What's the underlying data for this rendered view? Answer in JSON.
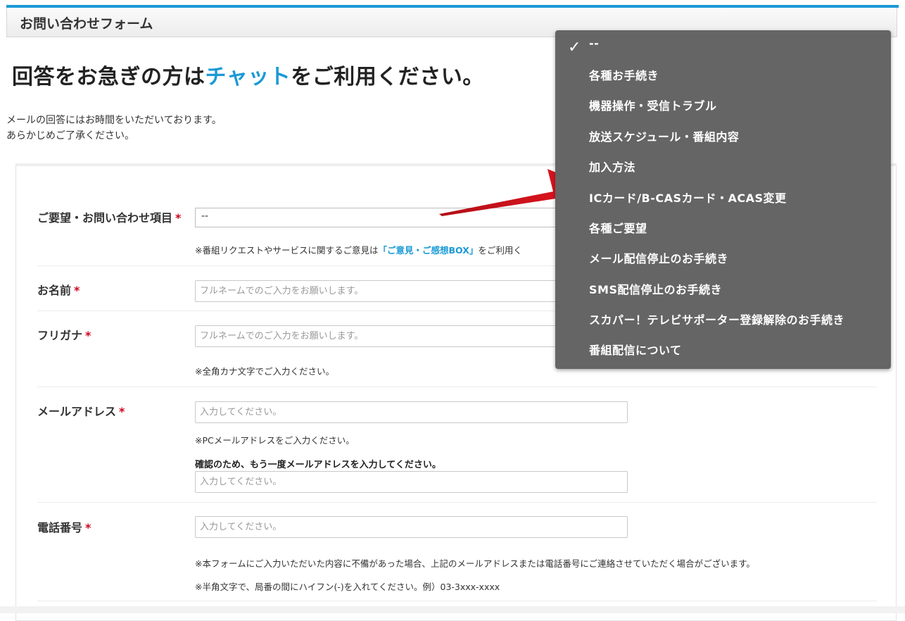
{
  "header": {
    "title": "お問い合わせフォーム"
  },
  "headline": {
    "before": "回答をお急ぎの方は",
    "chat_link": "チャット",
    "after": "をご利用ください。"
  },
  "intro": {
    "line1": "メールの回答にはお時間をいただいております。",
    "line2": "あらかじめご了承ください。"
  },
  "required_mark": "*",
  "fields": {
    "category": {
      "label": "ご要望・お問い合わせ項目",
      "selected": "--",
      "note_prefix": "※番組リクエストやサービスに関するご意見は",
      "note_link": "「ご意見・ご感想BOX」",
      "note_suffix": "をご利用く"
    },
    "name": {
      "label": "お名前",
      "placeholder": "フルネームでのご入力をお願いします。"
    },
    "furigana": {
      "label": "フリガナ",
      "placeholder": "フルネームでのご入力をお願いします。",
      "note": "※全角カナ文字でご入力ください。"
    },
    "email": {
      "label": "メールアドレス",
      "placeholder": "入力してください。",
      "note": "※PCメールアドレスをご入力ください。",
      "confirm_label": "確認のため、もう一度メールアドレスを入力してください。",
      "confirm_placeholder": "入力してください。"
    },
    "phone": {
      "label": "電話番号",
      "placeholder": "入力してください。",
      "note1": "※本フォームにご入力いただいた内容に不備があった場合、上記のメールアドレスまたは電話番号にご連絡させていただく場合がございます。",
      "note2": "※半角文字で、局番の間にハイフン(-)を入れてください。例）03-3xxx-xxxx"
    }
  },
  "dropdown": {
    "check_icon": "checkmark-icon",
    "options": [
      "--",
      "各種お手続き",
      "機器操作・受信トラブル",
      "放送スケジュール・番組内容",
      "加入方法",
      "ICカード/B-CASカード・ACAS変更",
      "各種ご要望",
      "メール配信停止のお手続き",
      "SMS配信停止のお手続き",
      "スカパー！テレビサポーター登録解除のお手続き",
      "番組配信について"
    ]
  },
  "annotation": {
    "arrow_icon": "red-arrow-icon",
    "color": "#e0141e"
  },
  "colors": {
    "accent": "#1a9ad6",
    "required": "#d0021b",
    "dropdown_bg": "#656565"
  }
}
